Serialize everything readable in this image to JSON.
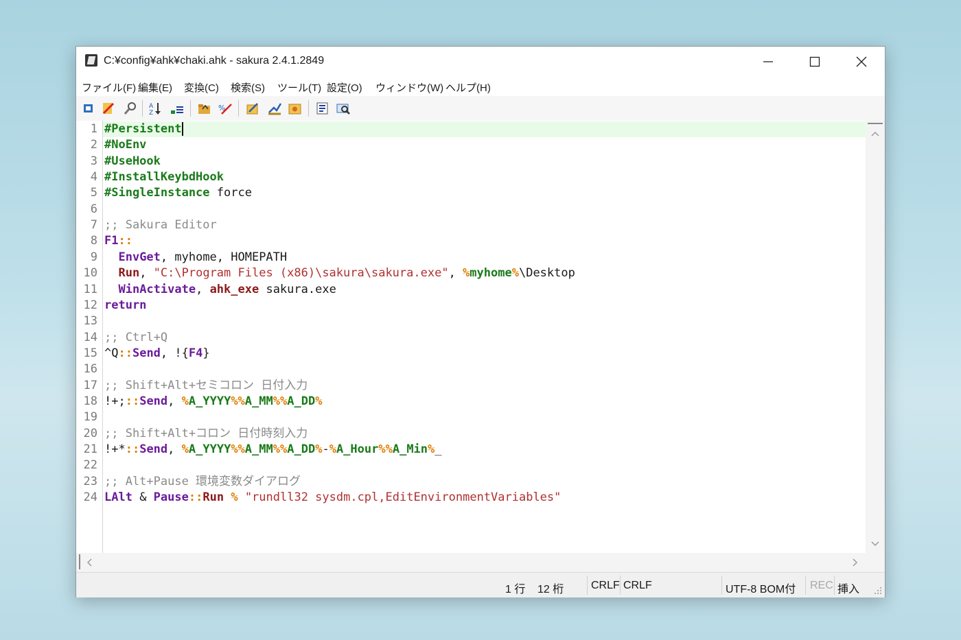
{
  "window": {
    "title": "C:¥config¥ahk¥chaki.ahk - sakura 2.4.1.2849"
  },
  "menu": [
    "ファイル(F)",
    "編集(E)",
    "変換(C)",
    "検索(S)",
    "ツール(T)",
    "設定(O)",
    "ウィンドウ(W)",
    "ヘルプ(H)"
  ],
  "toolbar": {
    "icons": [
      "new-file-icon",
      "close-file-icon",
      "find-icon",
      "sort-icon",
      "outline-icon",
      "open-folder-icon",
      "search-replace-icon",
      "settings-icon",
      "font-icon",
      "macro-icon",
      "list-icon",
      "options-icon"
    ]
  },
  "editor": {
    "lines": [
      {
        "n": "1",
        "segs": [
          [
            "kw",
            "#Persistent"
          ]
        ]
      },
      {
        "n": "2",
        "segs": [
          [
            "kw",
            "#NoEnv"
          ]
        ]
      },
      {
        "n": "3",
        "segs": [
          [
            "kw",
            "#UseHook"
          ]
        ]
      },
      {
        "n": "4",
        "segs": [
          [
            "kw",
            "#InstallKeybdHook"
          ]
        ]
      },
      {
        "n": "5",
        "segs": [
          [
            "kw",
            "#SingleInstance"
          ],
          [
            "",
            " force"
          ]
        ]
      },
      {
        "n": "6",
        "segs": []
      },
      {
        "n": "7",
        "segs": [
          [
            "cmt",
            ";; Sakura Editor"
          ]
        ]
      },
      {
        "n": "8",
        "segs": [
          [
            "kw2",
            "F1"
          ],
          [
            "pct",
            "::"
          ]
        ]
      },
      {
        "n": "9",
        "segs": [
          [
            "",
            "  "
          ],
          [
            "kw2",
            "EnvGet"
          ],
          [
            "",
            ", myhome, HOMEPATH"
          ]
        ]
      },
      {
        "n": "10",
        "segs": [
          [
            "",
            "  "
          ],
          [
            "kw3",
            "Run"
          ],
          [
            "",
            ", "
          ],
          [
            "str",
            "\"C:\\Program Files (x86)\\sakura\\sakura.exe\""
          ],
          [
            "",
            ", "
          ],
          [
            "pct",
            "%"
          ],
          [
            "var",
            "myhome"
          ],
          [
            "pct",
            "%"
          ],
          [
            "",
            "\\Desktop"
          ]
        ]
      },
      {
        "n": "11",
        "segs": [
          [
            "",
            "  "
          ],
          [
            "kw2",
            "WinActivate"
          ],
          [
            "",
            ", "
          ],
          [
            "kw3",
            "ahk_exe"
          ],
          [
            "",
            " sakura.exe"
          ]
        ]
      },
      {
        "n": "12",
        "segs": [
          [
            "kw2",
            "return"
          ]
        ]
      },
      {
        "n": "13",
        "segs": []
      },
      {
        "n": "14",
        "segs": [
          [
            "cmt",
            ";; Ctrl+Q"
          ]
        ]
      },
      {
        "n": "15",
        "segs": [
          [
            "",
            "^Q"
          ],
          [
            "pct",
            "::"
          ],
          [
            "kw2",
            "Send"
          ],
          [
            "",
            ", !{"
          ],
          [
            "kw2",
            "F4"
          ],
          [
            "",
            "}"
          ]
        ]
      },
      {
        "n": "16",
        "segs": []
      },
      {
        "n": "17",
        "segs": [
          [
            "cmt",
            ";; Shift+Alt+セミコロン 日付入力"
          ]
        ]
      },
      {
        "n": "18",
        "segs": [
          [
            "",
            "!+;"
          ],
          [
            "pct",
            "::"
          ],
          [
            "kw2",
            "Send"
          ],
          [
            "",
            ", "
          ],
          [
            "pct",
            "%"
          ],
          [
            "var",
            "A_YYYY"
          ],
          [
            "pct",
            "%%"
          ],
          [
            "var",
            "A_MM"
          ],
          [
            "pct",
            "%%"
          ],
          [
            "var",
            "A_DD"
          ],
          [
            "pct",
            "%"
          ]
        ]
      },
      {
        "n": "19",
        "segs": []
      },
      {
        "n": "20",
        "segs": [
          [
            "cmt",
            ";; Shift+Alt+コロン 日付時刻入力"
          ]
        ]
      },
      {
        "n": "21",
        "segs": [
          [
            "",
            "!+*"
          ],
          [
            "pct",
            "::"
          ],
          [
            "kw2",
            "Send"
          ],
          [
            "",
            ", "
          ],
          [
            "pct",
            "%"
          ],
          [
            "var",
            "A_YYYY"
          ],
          [
            "pct",
            "%%"
          ],
          [
            "var",
            "A_MM"
          ],
          [
            "pct",
            "%%"
          ],
          [
            "var",
            "A_DD"
          ],
          [
            "pct",
            "%"
          ],
          [
            "",
            "-"
          ],
          [
            "pct",
            "%"
          ],
          [
            "var",
            "A_Hour"
          ],
          [
            "pct",
            "%%"
          ],
          [
            "var",
            "A_Min"
          ],
          [
            "pct",
            "%"
          ],
          [
            "",
            "_"
          ]
        ]
      },
      {
        "n": "22",
        "segs": []
      },
      {
        "n": "23",
        "segs": [
          [
            "cmt",
            ";; Alt+Pause 環境変数ダイアログ"
          ]
        ]
      },
      {
        "n": "24",
        "segs": [
          [
            "kw2",
            "LAlt"
          ],
          [
            "",
            " & "
          ],
          [
            "kw2",
            "Pause"
          ],
          [
            "pct",
            "::"
          ],
          [
            "kw3",
            "Run"
          ],
          [
            "",
            " "
          ],
          [
            "pct",
            "%"
          ],
          [
            "",
            " "
          ],
          [
            "str",
            "\"rundll32 sysdm.cpl,EditEnvironmentVariables\""
          ]
        ]
      }
    ]
  },
  "status": {
    "line": "1 行",
    "col": "12 桁",
    "eol1": "CRLF",
    "eol2": "CRLF",
    "encoding": "UTF-8 BOM付",
    "rec": "REC",
    "mode": "挿入"
  },
  "colors": {
    "current_line": "#e8fbe8",
    "keyword_green": "#1a7a1a",
    "keyword_purple": "#6a1b9a",
    "string_red": "#b03030",
    "percent_orange": "#e07d00"
  }
}
